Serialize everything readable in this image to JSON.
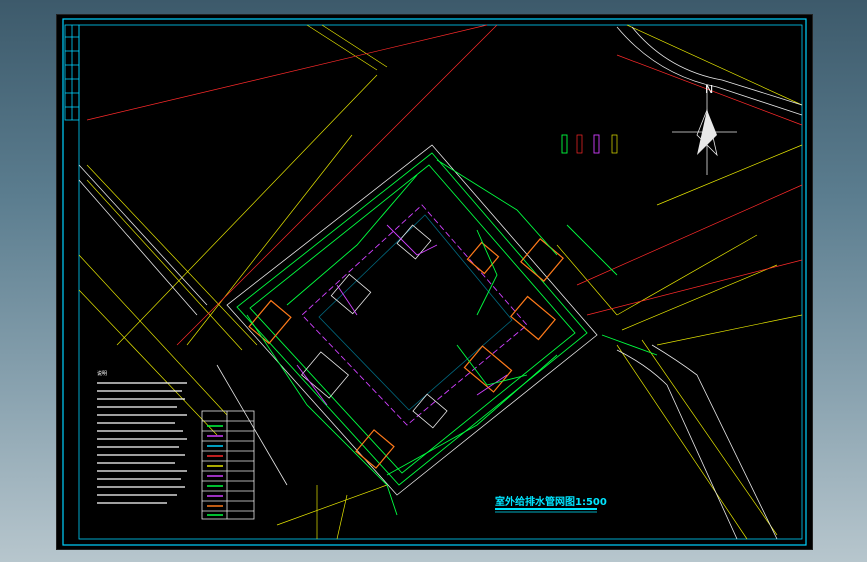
{
  "drawing": {
    "title": "室外给排水管网图1:500",
    "north_label": "N",
    "legend_label": "图例",
    "legend_rows": 10,
    "notes_title": "说明",
    "colors": {
      "frame": "#00d2ff",
      "road": "#e6e600",
      "boundary": "#ff2a2a",
      "water_pipe": "#00ff40",
      "drain_pipe": "#d040ff",
      "building": "#ff7a1a",
      "outline": "#e8e8e8"
    }
  }
}
